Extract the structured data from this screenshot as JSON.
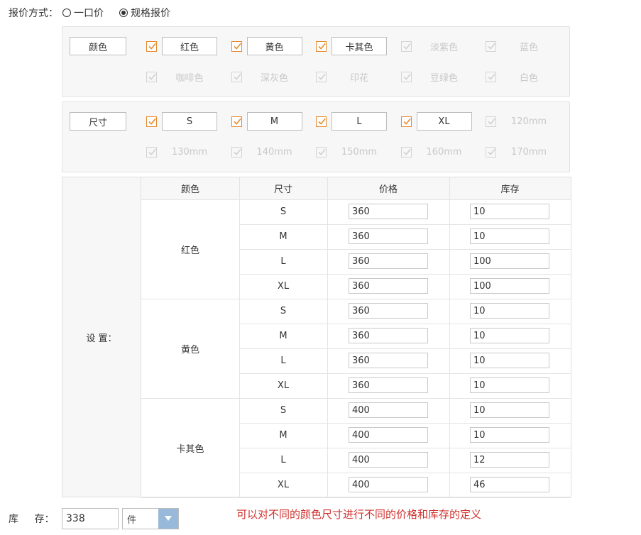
{
  "pricing": {
    "label": "报价方式：",
    "options": [
      {
        "label": "一口价",
        "selected": false
      },
      {
        "label": "规格报价",
        "selected": true
      }
    ]
  },
  "color_group": {
    "label": "颜色",
    "options": [
      {
        "name": "红色",
        "checked": true
      },
      {
        "name": "黄色",
        "checked": true
      },
      {
        "name": "卡其色",
        "checked": true
      },
      {
        "name": "淡紫色",
        "checked": false
      },
      {
        "name": "蓝色",
        "checked": false
      },
      {
        "name": "咖啡色",
        "checked": false
      },
      {
        "name": "深灰色",
        "checked": false
      },
      {
        "name": "印花",
        "checked": false
      },
      {
        "name": "豆绿色",
        "checked": false
      },
      {
        "name": "白色",
        "checked": false
      }
    ]
  },
  "size_group": {
    "label": "尺寸",
    "options": [
      {
        "name": "S",
        "checked": true
      },
      {
        "name": "M",
        "checked": true
      },
      {
        "name": "L",
        "checked": true
      },
      {
        "name": "XL",
        "checked": true
      },
      {
        "name": "120mm",
        "checked": false
      },
      {
        "name": "130mm",
        "checked": false
      },
      {
        "name": "140mm",
        "checked": false
      },
      {
        "name": "150mm",
        "checked": false
      },
      {
        "name": "160mm",
        "checked": false
      },
      {
        "name": "170mm",
        "checked": false
      }
    ]
  },
  "settings": {
    "label": "设 置：",
    "headers": [
      "颜色",
      "尺寸",
      "价格",
      "库存"
    ],
    "groups": [
      {
        "color": "红色",
        "rows": [
          {
            "size": "S",
            "price": "360",
            "stock": "10"
          },
          {
            "size": "M",
            "price": "360",
            "stock": "10"
          },
          {
            "size": "L",
            "price": "360",
            "stock": "100"
          },
          {
            "size": "XL",
            "price": "360",
            "stock": "100"
          }
        ]
      },
      {
        "color": "黄色",
        "rows": [
          {
            "size": "S",
            "price": "360",
            "stock": "10"
          },
          {
            "size": "M",
            "price": "360",
            "stock": "10"
          },
          {
            "size": "L",
            "price": "360",
            "stock": "10"
          },
          {
            "size": "XL",
            "price": "360",
            "stock": "10"
          }
        ]
      },
      {
        "color": "卡其色",
        "rows": [
          {
            "size": "S",
            "price": "400",
            "stock": "10"
          },
          {
            "size": "M",
            "price": "400",
            "stock": "10"
          },
          {
            "size": "L",
            "price": "400",
            "stock": "12"
          },
          {
            "size": "XL",
            "price": "400",
            "stock": "46"
          }
        ]
      }
    ]
  },
  "stock": {
    "label": "库 存：",
    "value": "338",
    "unit": "件"
  },
  "note": "可以对不同的颜色尺寸进行不同的价格和库存的定义",
  "colors": {
    "accent_check": "#e68a2e",
    "note_text": "#d0312d",
    "select_arrow_bg": "#98b9d9"
  }
}
